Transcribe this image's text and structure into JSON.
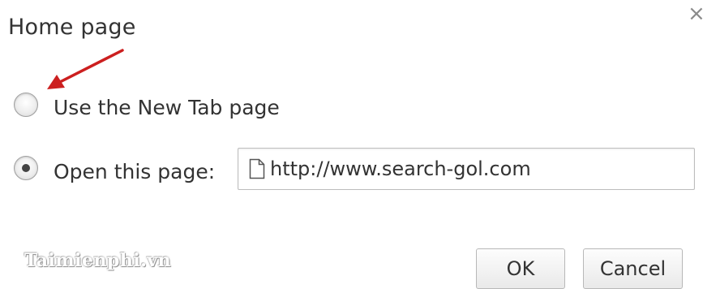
{
  "dialog": {
    "title": "Home page",
    "close_glyph": "×",
    "close_icon": "close-icon"
  },
  "options": {
    "new_tab": {
      "label": "Use the New Tab page",
      "selected": false
    },
    "open_page": {
      "label": "Open this page:",
      "selected": true,
      "url_value": "http://www.search-gol.com",
      "url_icon": "page-icon"
    }
  },
  "annotation": {
    "arrow_color": "#cc1f1f"
  },
  "watermark": {
    "text": "Taimienphi.vn"
  },
  "buttons": {
    "ok_label": "OK",
    "cancel_label": "Cancel"
  }
}
